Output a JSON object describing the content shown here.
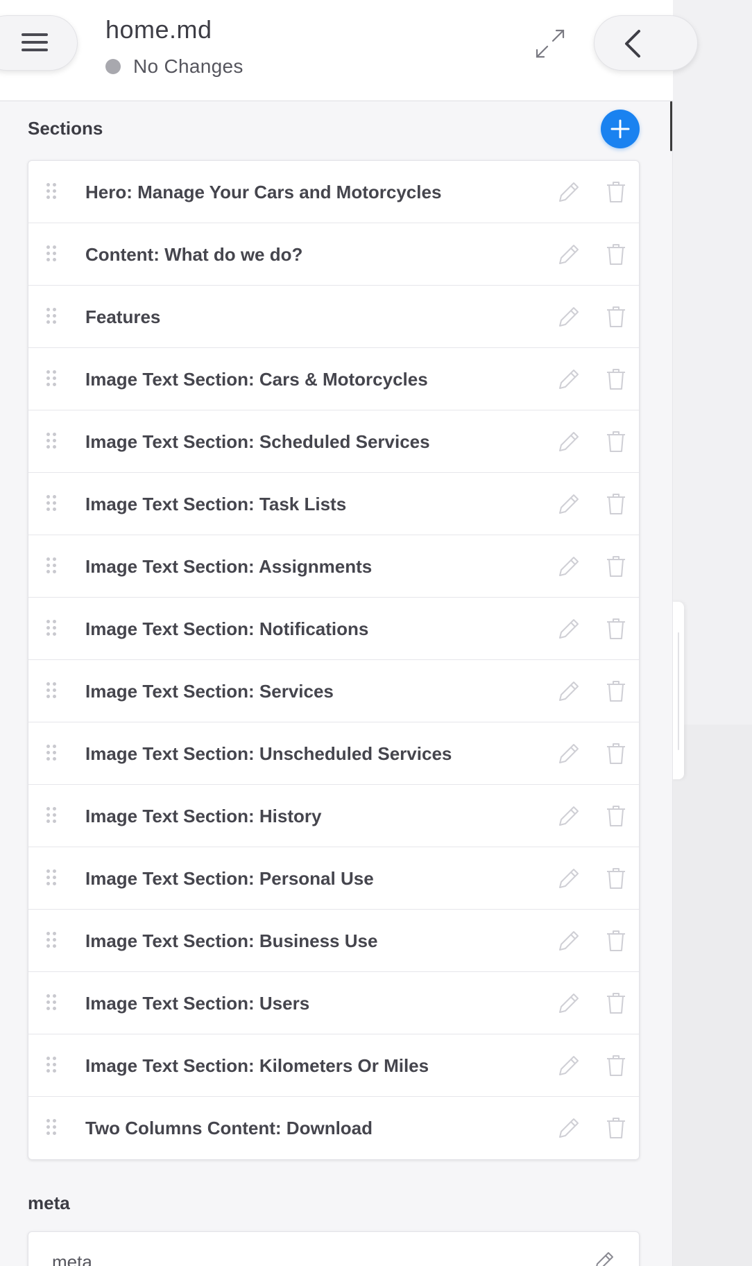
{
  "header": {
    "file_name": "home.md",
    "status": "No Changes",
    "menu_icon": "hamburger-menu-icon",
    "expand_icon": "expand-arrows-icon",
    "back_icon": "chevron-left-icon"
  },
  "sections": {
    "heading": "Sections",
    "add_icon": "plus-icon",
    "items": [
      {
        "label": "Hero: Manage Your Cars and Motorcycles"
      },
      {
        "label": "Content: What do we do?"
      },
      {
        "label": "Features"
      },
      {
        "label": "Image Text Section: Cars & Motorcycles"
      },
      {
        "label": "Image Text Section: Scheduled Services"
      },
      {
        "label": "Image Text Section: Task Lists"
      },
      {
        "label": "Image Text Section: Assignments"
      },
      {
        "label": "Image Text Section: Notifications"
      },
      {
        "label": "Image Text Section: Services"
      },
      {
        "label": "Image Text Section: Unscheduled Services"
      },
      {
        "label": "Image Text Section: History"
      },
      {
        "label": "Image Text Section: Personal Use"
      },
      {
        "label": "Image Text Section: Business Use"
      },
      {
        "label": "Image Text Section: Users"
      },
      {
        "label": "Image Text Section: Kilometers Or Miles"
      },
      {
        "label": "Two Columns Content: Download"
      }
    ]
  },
  "meta": {
    "heading": "meta",
    "card_label": "meta"
  },
  "colors": {
    "accent": "#1a82f0",
    "status_dot": "#a8a8ae",
    "text": "#45454d"
  }
}
